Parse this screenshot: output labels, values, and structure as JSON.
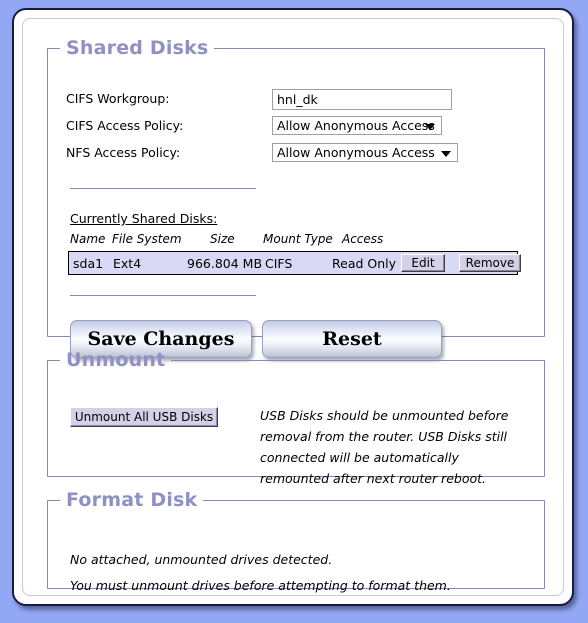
{
  "sections": {
    "shared_disks": {
      "legend": "Shared Disks",
      "fields": [
        {
          "label": "CIFS Workgroup:",
          "type": "text",
          "value": "hnl_dk"
        },
        {
          "label": "CIFS Access Policy:",
          "type": "select",
          "value": "Allow Anonymous Access"
        },
        {
          "label": "NFS Access Policy:",
          "type": "select",
          "value": "Allow Anonymous Access"
        }
      ],
      "table": {
        "caption": "Currently Shared Disks:",
        "columns": [
          "Name",
          "File System",
          "Size",
          "Mount Type",
          "Access"
        ],
        "rows": [
          {
            "name": "sda1",
            "file_system": "Ext4",
            "size": "966.804 MB",
            "mount_type": "CIFS",
            "access": "Read Only",
            "edit_label": "Edit",
            "remove_label": "Remove"
          }
        ]
      },
      "buttons": {
        "save": "Save Changes",
        "reset": "Reset"
      }
    },
    "unmount": {
      "legend": "Unmount",
      "button_label": "Unmount All USB Disks",
      "note": "USB Disks should be unmounted before removal from the router. USB Disks still connected will be automatically remounted after next router reboot."
    },
    "format_disk": {
      "legend": "Format Disk",
      "line1": "No attached, unmounted drives detected.",
      "line2": "You must unmount drives before attempting to format them."
    }
  },
  "colors": {
    "page_background": "#93a8f4",
    "legend_text": "#8f90c4",
    "section_border": "#8587bd",
    "row_highlight": "#d9d9f5",
    "frame_border": "#1b1b3a"
  }
}
